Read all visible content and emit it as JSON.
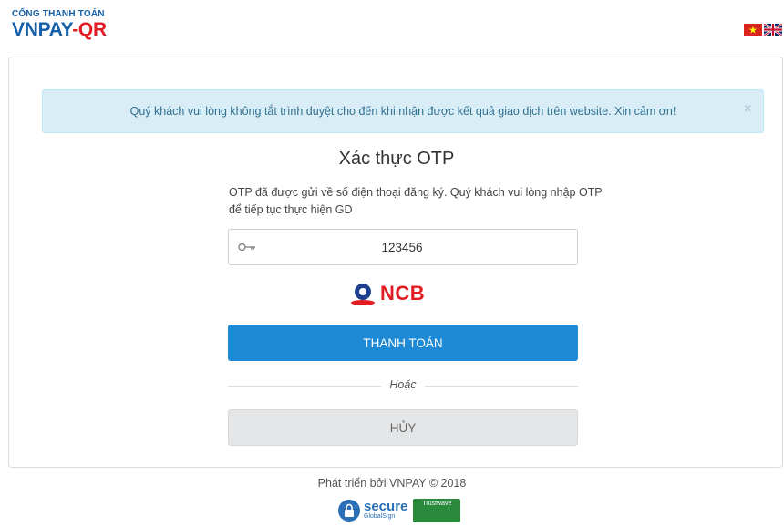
{
  "header": {
    "logo_top": "CỔNG THANH TOÁN",
    "logo_vnpay": "VNPAY",
    "logo_qr": "-QR"
  },
  "alert": {
    "message": "Quý khách vui lòng không tắt trình duyệt cho đến khi nhận được kết quả giao dịch trên website. Xin cảm ơn!",
    "close": "×"
  },
  "otp": {
    "title": "Xác thực OTP",
    "description": "OTP đã được gửi về số điện thoại đăng ký. Quý khách vui lòng nhập OTP để tiếp tục thực hiện GD",
    "value": "123456"
  },
  "bank": {
    "name": "NCB"
  },
  "actions": {
    "pay_label": "THANH TOÁN",
    "or_label": "Hoặc",
    "cancel_label": "HỦY"
  },
  "footer": {
    "text": "Phát triển bởi VNPAY © 2018",
    "secure_label": "secure",
    "globalsign_label": "GlobalSign",
    "trustwave_label": "Trustwave"
  },
  "colors": {
    "brand_blue": "#1560a8",
    "brand_red": "#e31b23",
    "pay_button": "#1e8ad6",
    "alert_bg": "#d9edf7"
  }
}
